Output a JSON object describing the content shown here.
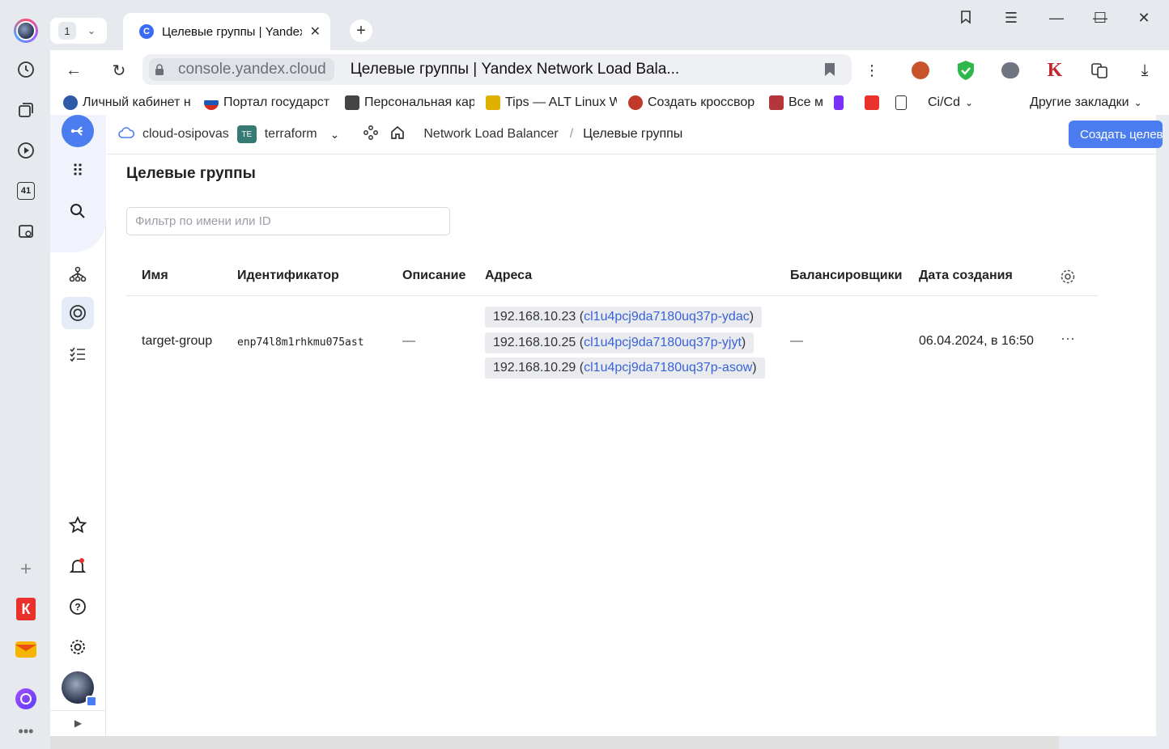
{
  "browser": {
    "tab_count": "1",
    "tab_title": "Целевые группы | Yandex",
    "tab_favicon": "C",
    "domain": "console.yandex.cloud",
    "page_title": "Целевые группы | Yandex Network Load Bala...",
    "bookmarks": [
      {
        "label": "Личный кабинет н",
        "icon": "gov-emblem-icon",
        "color": "#2f5aa8"
      },
      {
        "label": "Портал государст",
        "icon": "russia-flag-icon",
        "color": "#d52b1e"
      },
      {
        "label": "Персональная кар",
        "icon": "card-icon",
        "color": "#444444"
      },
      {
        "label": "Tips — ALT Linux W",
        "icon": "alt-linux-icon",
        "color": "#e0b000"
      },
      {
        "label": "Создать кроссвор",
        "icon": "ladybug-icon",
        "color": "#c0392b"
      },
      {
        "label": "Все м",
        "icon": "bars-icon",
        "color": "#b5363a"
      }
    ],
    "bookmark_folder": "Ci/Cd",
    "other_bookmarks": "Другие закладки",
    "sidebar_badge": "41"
  },
  "console": {
    "cloud": "cloud-osipovas",
    "folder_badge": "TE",
    "folder": "terraform",
    "crumb_service": "Network Load Balancer",
    "crumb_separator": "/",
    "crumb_current": "Целевые группы",
    "create_button": "Создать целевую группу",
    "page_title": "Целевые группы",
    "filter_placeholder": "Фильтр по имени или ID",
    "columns": {
      "name": "Имя",
      "id": "Идентификатор",
      "description": "Описание",
      "addresses": "Адреса",
      "balancers": "Балансировщики",
      "created": "Дата создания"
    },
    "rows": [
      {
        "name": "target-group",
        "id": "enp74l8m1rhkmu075ast",
        "description": "—",
        "addresses": [
          {
            "ip": "192.168.10.23",
            "instance": "cl1u4pcj9da7180uq37p-ydac"
          },
          {
            "ip": "192.168.10.25",
            "instance": "cl1u4pcj9da7180uq37p-yjyt"
          },
          {
            "ip": "192.168.10.29",
            "instance": "cl1u4pcj9da7180uq37p-asow"
          }
        ],
        "balancers": "—",
        "created": "06.04.2024, в 16:50"
      }
    ]
  },
  "colors": {
    "accent": "#4c7df0",
    "link": "#3a62d8",
    "folder_badge": "#367a74"
  }
}
